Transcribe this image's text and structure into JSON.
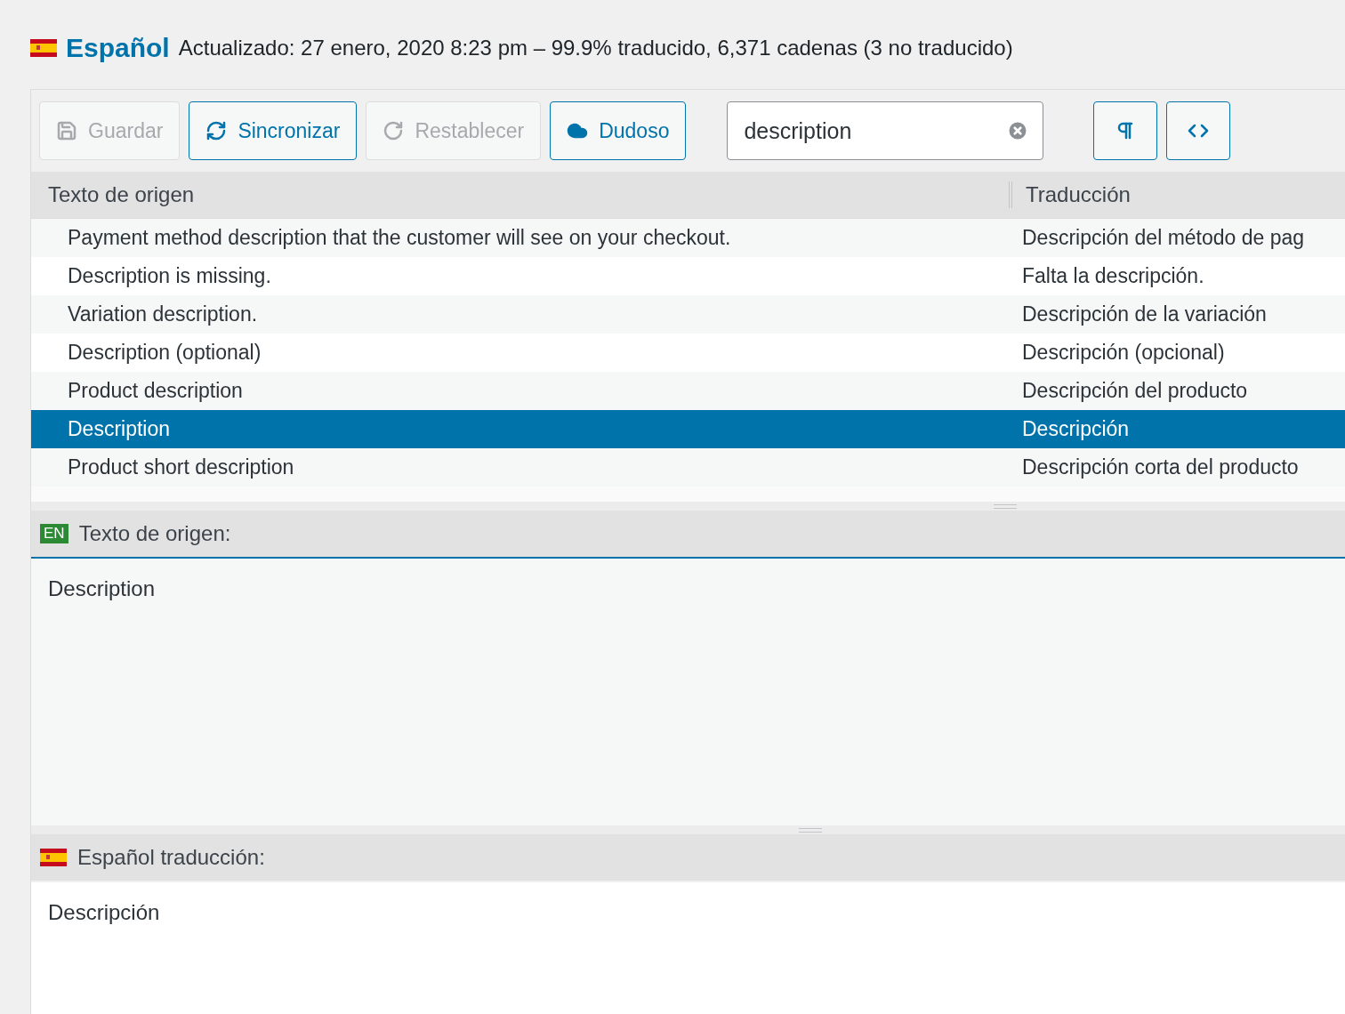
{
  "language": {
    "name": "Español",
    "status": "Actualizado: 27 enero, 2020 8:23 pm – 99.9% traducido, 6,371 cadenas (3 no traducido)"
  },
  "toolbar": {
    "buttons": [
      {
        "kind": "save",
        "label": "Guardar",
        "disabled": true
      },
      {
        "kind": "sync",
        "label": "Sincronizar",
        "disabled": false
      },
      {
        "kind": "revert",
        "label": "Restablecer",
        "disabled": true
      },
      {
        "kind": "fuzzy",
        "label": "Dudoso",
        "disabled": false
      }
    ],
    "search": {
      "value": "description"
    },
    "toggles": [
      {
        "kind": "pilcrow"
      },
      {
        "kind": "code"
      }
    ]
  },
  "table": {
    "columns": [
      "Texto de origen",
      "Traducción"
    ],
    "rows": [
      {
        "source": "Payment method description that the customer will see on your checkout.",
        "translation": "Descripción del método de pag",
        "selected": false
      },
      {
        "source": "Description is missing.",
        "translation": "Falta la descripción.",
        "selected": false
      },
      {
        "source": "Variation description.",
        "translation": "Descripción de la variación",
        "selected": false
      },
      {
        "source": "Description (optional)",
        "translation": "Descripción (opcional)",
        "selected": false
      },
      {
        "source": "Product description",
        "translation": "Descripción del producto",
        "selected": false
      },
      {
        "source": "Description",
        "translation": "Descripción",
        "selected": true
      },
      {
        "source": "Product short description",
        "translation": "Descripción corta del producto",
        "selected": false
      }
    ]
  },
  "source_editor": {
    "badge": "EN",
    "title": "Texto de origen:",
    "text": "Description"
  },
  "translation_editor": {
    "title": "Español traducción:",
    "text": "Descripción"
  }
}
